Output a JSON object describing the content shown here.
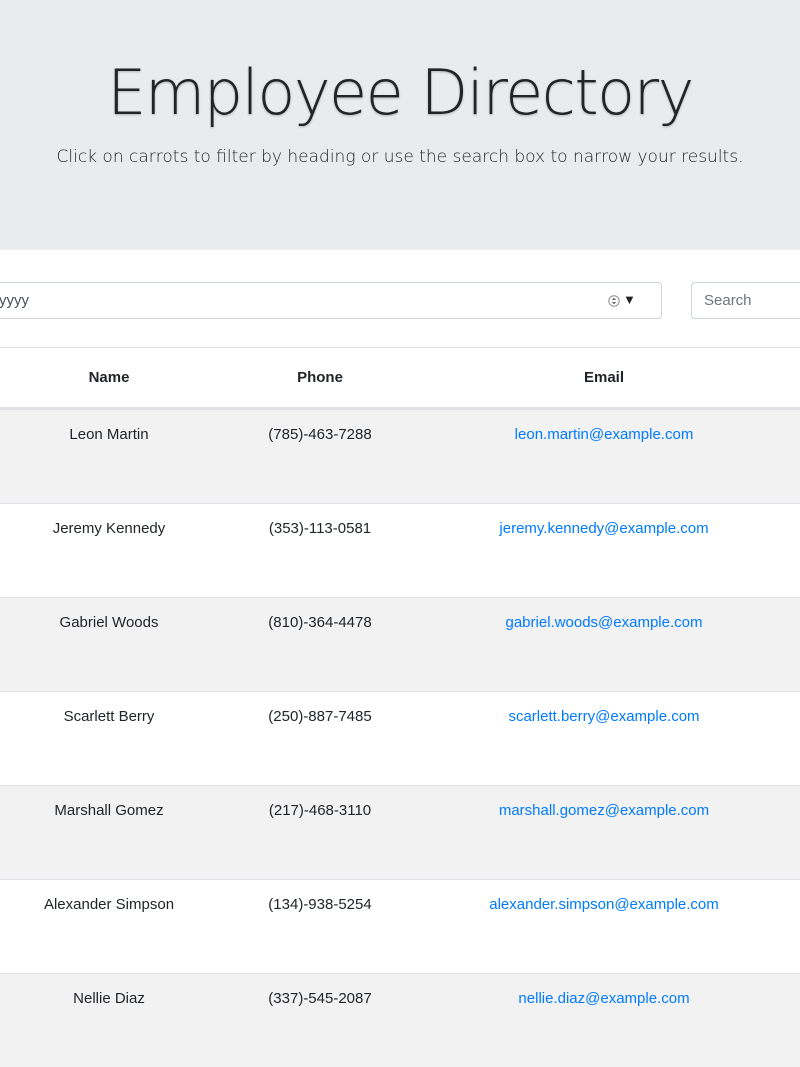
{
  "header": {
    "title": "Employee Directory",
    "subtitle": "Click on carrots to filter by heading or use the search box to narrow your results."
  },
  "controls": {
    "date_value": "yyyy",
    "search_placeholder": "Search"
  },
  "table": {
    "columns": [
      "Name",
      "Phone",
      "Email"
    ],
    "rows": [
      {
        "name": "Leon Martin",
        "phone": "(785)-463-7288",
        "email": "leon.martin@example.com"
      },
      {
        "name": "Jeremy Kennedy",
        "phone": "(353)-113-0581",
        "email": "jeremy.kennedy@example.com"
      },
      {
        "name": "Gabriel Woods",
        "phone": "(810)-364-4478",
        "email": "gabriel.woods@example.com"
      },
      {
        "name": "Scarlett Berry",
        "phone": "(250)-887-7485",
        "email": "scarlett.berry@example.com"
      },
      {
        "name": "Marshall Gomez",
        "phone": "(217)-468-3110",
        "email": "marshall.gomez@example.com"
      },
      {
        "name": "Alexander Simpson",
        "phone": "(134)-938-5254",
        "email": "alexander.simpson@example.com"
      },
      {
        "name": "Nellie Diaz",
        "phone": "(337)-545-2087",
        "email": "nellie.diaz@example.com"
      }
    ]
  },
  "colors": {
    "jumbotron_bg": "#e9ecef",
    "link": "#007bff",
    "stripe": "#f2f2f2"
  },
  "icons": {
    "spinner": "spin-updown-icon",
    "dropdown": "caret-down-icon"
  }
}
